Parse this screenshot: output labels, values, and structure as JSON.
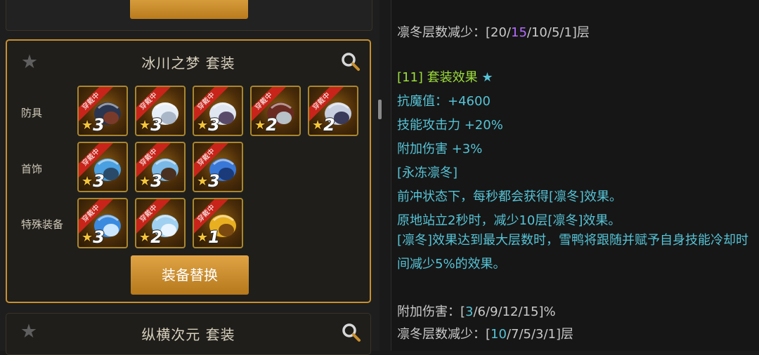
{
  "left": {
    "set_main": {
      "title": "冰川之梦  套装",
      "rows": [
        {
          "label": "防具",
          "items": [
            {
              "badge": "穿戴中",
              "grade": "3"
            },
            {
              "badge": "穿戴中",
              "grade": "3"
            },
            {
              "badge": "穿戴中",
              "grade": "3"
            },
            {
              "badge": "穿戴中",
              "grade": "2"
            },
            {
              "badge": "穿戴中",
              "grade": "2"
            }
          ]
        },
        {
          "label": "首饰",
          "items": [
            {
              "badge": "穿戴中",
              "grade": "3"
            },
            {
              "badge": "穿戴中",
              "grade": "3"
            },
            {
              "badge": "穿戴中",
              "grade": "3"
            }
          ]
        },
        {
          "label": "特殊装备",
          "items": [
            {
              "badge": "穿戴中",
              "grade": "3"
            },
            {
              "badge": "穿戴中",
              "grade": "2"
            },
            {
              "badge": "穿戴中",
              "grade": "1"
            }
          ]
        }
      ],
      "swap_label": "装备替换"
    },
    "set_next": {
      "title": "纵横次元  套装"
    }
  },
  "right": {
    "l1_label": "凛冬层数减少：",
    "l1_a": "[20/",
    "l1_b": "15",
    "l1_c": "/10/5/1]层",
    "set_effect_tag": "[11] 套装效果",
    "set_effect_star": "★",
    "stats": [
      "抗魔值：+4600",
      "技能攻击力 +20%",
      "附加伤害 +3%",
      "[永冻凛冬]",
      "前冲状态下，每秒都会获得[凛冬]效果。",
      "原地站立2秒时，减少10层[凛冬]效果。",
      "[凛冬]效果达到最大层数时，雪鸭将跟随并赋予自身技能冷却时间减少5%的效果。"
    ],
    "l2_label": "附加伤害：",
    "l2_a": "[",
    "l2_b": "3",
    "l2_c": "/6/9/12/15]%",
    "l3_label": "凛冬层数减少：",
    "l3_a": "[",
    "l3_b": "10",
    "l3_c": "/7/5/3/1]层"
  },
  "colors": {
    "accent": "#c7902e",
    "cyan": "#56c3d6",
    "green": "#9ddf3a",
    "purple": "#b46cff",
    "badge": "#c8241a"
  }
}
